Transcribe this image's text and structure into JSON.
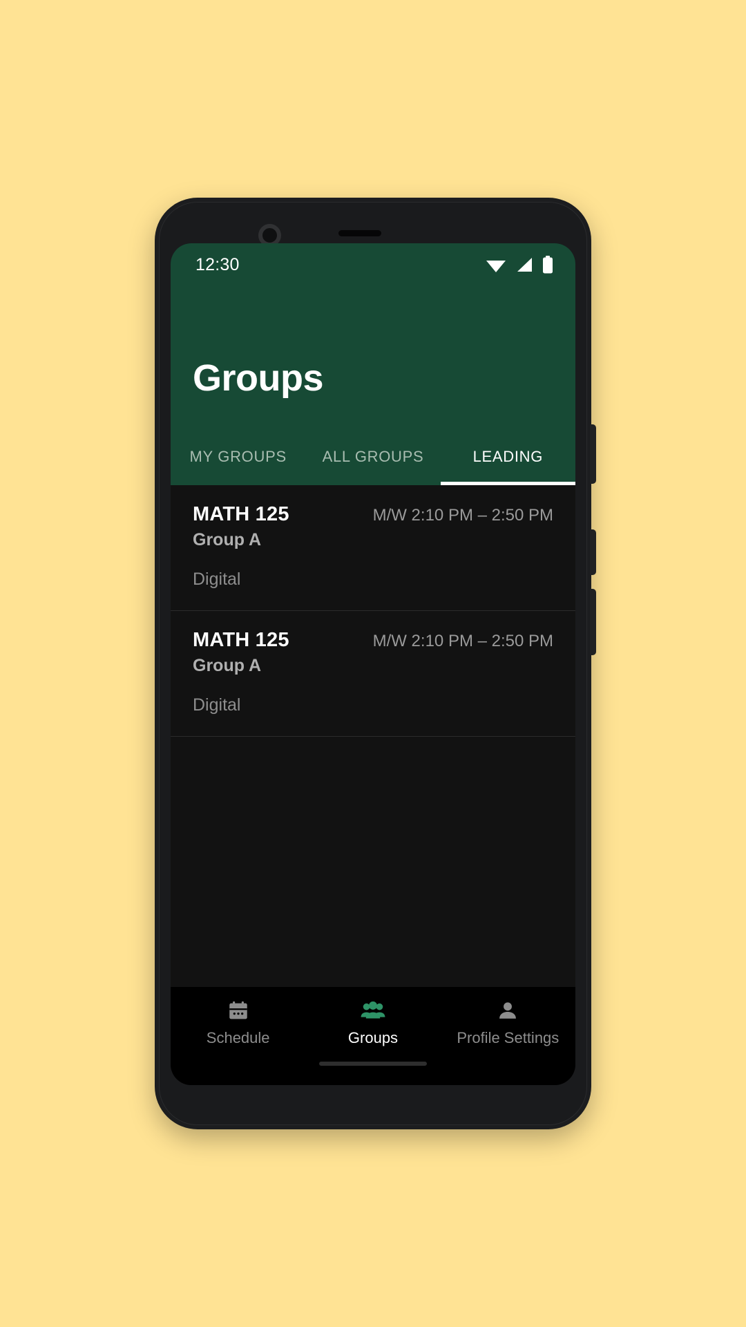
{
  "theme": {
    "page_background": "#ffe394",
    "header_green": "#174a35",
    "screen_background": "#121212",
    "nav_background": "#000000",
    "accent_green": "#2e9367",
    "muted_text": "#9a9a9a"
  },
  "status_bar": {
    "time": "12:30",
    "icons": [
      "wifi-icon",
      "cellular-signal-icon",
      "battery-icon"
    ]
  },
  "header": {
    "title": "Groups"
  },
  "tabs": [
    {
      "label": "MY GROUPS",
      "active": false
    },
    {
      "label": "ALL GROUPS",
      "active": false
    },
    {
      "label": "LEADING",
      "active": true
    }
  ],
  "groups": [
    {
      "course": "MATH 125",
      "time": "M/W 2:10 PM – 2:50 PM",
      "group": "Group A",
      "modality": "Digital"
    },
    {
      "course": "MATH 125",
      "time": "M/W 2:10 PM – 2:50 PM",
      "group": "Group A",
      "modality": "Digital"
    }
  ],
  "bottom_nav": [
    {
      "label": "Schedule",
      "icon": "calendar-icon",
      "active": false
    },
    {
      "label": "Groups",
      "icon": "people-icon",
      "active": true
    },
    {
      "label": "Profile Settings",
      "icon": "person-icon",
      "active": false
    }
  ]
}
